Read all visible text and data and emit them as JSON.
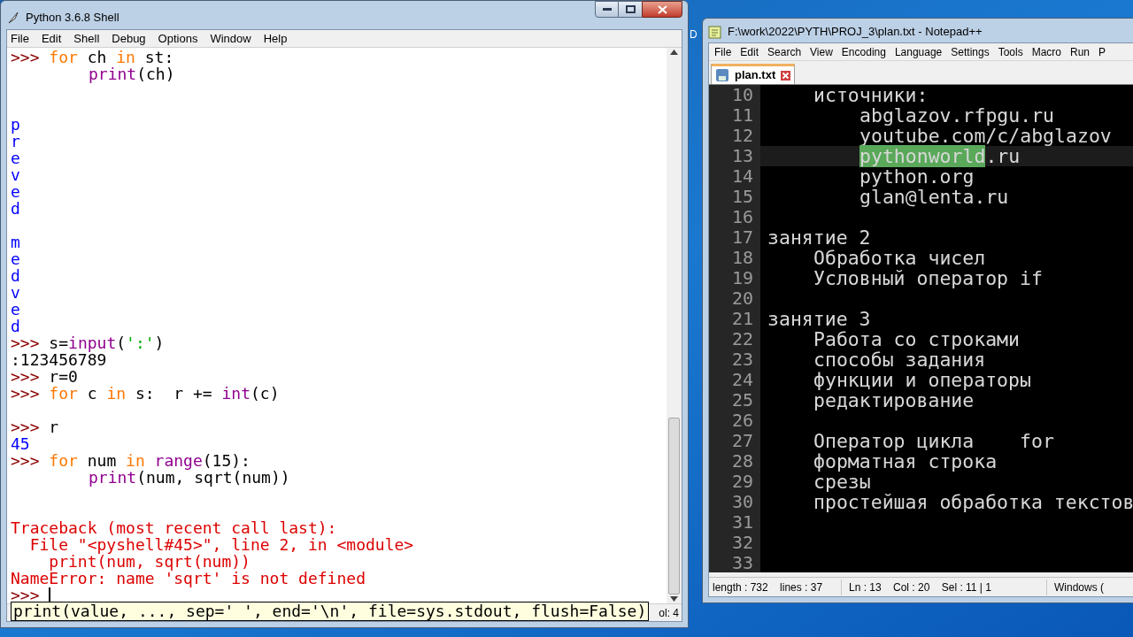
{
  "desktop": {
    "label": "D"
  },
  "shell": {
    "title": "Python 3.6.8 Shell",
    "menu": [
      "File",
      "Edit",
      "Shell",
      "Debug",
      "Options",
      "Window",
      "Help"
    ],
    "lines": [
      {
        "kind": "input",
        "segments": [
          {
            "kind": "prompt",
            "text": ">>> "
          },
          {
            "kind": "keyword",
            "text": "for"
          },
          {
            "kind": "plain",
            "text": " ch "
          },
          {
            "kind": "keyword",
            "text": "in"
          },
          {
            "kind": "plain",
            "text": " st:"
          }
        ]
      },
      {
        "kind": "continuation",
        "segments": [
          {
            "kind": "builtin",
            "text": "print"
          },
          {
            "kind": "plain",
            "text": "(ch)"
          }
        ]
      },
      {
        "kind": "blank"
      },
      {
        "kind": "blank"
      },
      {
        "kind": "input",
        "segments": [
          {
            "kind": "output",
            "text": "p"
          }
        ]
      },
      {
        "kind": "input",
        "segments": [
          {
            "kind": "output",
            "text": "r"
          }
        ]
      },
      {
        "kind": "input",
        "segments": [
          {
            "kind": "output",
            "text": "e"
          }
        ]
      },
      {
        "kind": "input",
        "segments": [
          {
            "kind": "output",
            "text": "v"
          }
        ]
      },
      {
        "kind": "input",
        "segments": [
          {
            "kind": "output",
            "text": "e"
          }
        ]
      },
      {
        "kind": "input",
        "segments": [
          {
            "kind": "output",
            "text": "d"
          }
        ]
      },
      {
        "kind": "blank"
      },
      {
        "kind": "input",
        "segments": [
          {
            "kind": "output",
            "text": "m"
          }
        ]
      },
      {
        "kind": "input",
        "segments": [
          {
            "kind": "output",
            "text": "e"
          }
        ]
      },
      {
        "kind": "input",
        "segments": [
          {
            "kind": "output",
            "text": "d"
          }
        ]
      },
      {
        "kind": "input",
        "segments": [
          {
            "kind": "output",
            "text": "v"
          }
        ]
      },
      {
        "kind": "input",
        "segments": [
          {
            "kind": "output",
            "text": "e"
          }
        ]
      },
      {
        "kind": "input",
        "segments": [
          {
            "kind": "output",
            "text": "d"
          }
        ]
      },
      {
        "kind": "input",
        "segments": [
          {
            "kind": "prompt",
            "text": ">>> "
          },
          {
            "kind": "plain",
            "text": "s="
          },
          {
            "kind": "builtin",
            "text": "input"
          },
          {
            "kind": "plain",
            "text": "("
          },
          {
            "kind": "string",
            "text": "':'"
          },
          {
            "kind": "plain",
            "text": ")"
          }
        ]
      },
      {
        "kind": "input",
        "segments": [
          {
            "kind": "plain",
            "text": ":123456789"
          }
        ]
      },
      {
        "kind": "input",
        "segments": [
          {
            "kind": "prompt",
            "text": ">>> "
          },
          {
            "kind": "plain",
            "text": "r=0"
          }
        ]
      },
      {
        "kind": "input",
        "segments": [
          {
            "kind": "prompt",
            "text": ">>> "
          },
          {
            "kind": "keyword",
            "text": "for"
          },
          {
            "kind": "plain",
            "text": " c "
          },
          {
            "kind": "keyword",
            "text": "in"
          },
          {
            "kind": "plain",
            "text": " s:  r += "
          },
          {
            "kind": "builtin",
            "text": "int"
          },
          {
            "kind": "plain",
            "text": "(c)"
          }
        ]
      },
      {
        "kind": "blank"
      },
      {
        "kind": "input",
        "segments": [
          {
            "kind": "prompt",
            "text": ">>> "
          },
          {
            "kind": "plain",
            "text": "r"
          }
        ]
      },
      {
        "kind": "input",
        "segments": [
          {
            "kind": "output",
            "text": "45"
          }
        ]
      },
      {
        "kind": "input",
        "segments": [
          {
            "kind": "prompt",
            "text": ">>> "
          },
          {
            "kind": "keyword",
            "text": "for"
          },
          {
            "kind": "plain",
            "text": " num "
          },
          {
            "kind": "keyword",
            "text": "in "
          },
          {
            "kind": "builtin",
            "text": "range"
          },
          {
            "kind": "plain",
            "text": "(15):"
          }
        ]
      },
      {
        "kind": "continuation",
        "segments": [
          {
            "kind": "builtin",
            "text": "print"
          },
          {
            "kind": "plain",
            "text": "(num, sqrt(num))"
          }
        ]
      },
      {
        "kind": "blank"
      },
      {
        "kind": "blank"
      },
      {
        "kind": "input",
        "segments": [
          {
            "kind": "error",
            "text": "Traceback (most recent call last):"
          }
        ]
      },
      {
        "kind": "input",
        "segments": [
          {
            "kind": "error",
            "text": "  File \"<pyshell#45>\", line 2, in <module>"
          }
        ]
      },
      {
        "kind": "input",
        "segments": [
          {
            "kind": "error",
            "text": "    print(num, sqrt(num))"
          }
        ]
      },
      {
        "kind": "input",
        "segments": [
          {
            "kind": "error",
            "text": "NameError: name 'sqrt' is not defined"
          }
        ]
      },
      {
        "kind": "input",
        "segments": [
          {
            "kind": "prompt",
            "text": ">>> "
          }
        ],
        "cursor": true
      }
    ],
    "calltip": "print(value, ..., sep=' ', end='\\n', file=sys.stdout, flush=False)",
    "status": "ol: 4"
  },
  "notepad": {
    "title": "F:\\work\\2022\\PYTH\\PROJ_3\\plan.txt - Notepad++",
    "menu": [
      "File",
      "Edit",
      "Search",
      "View",
      "Encoding",
      "Language",
      "Settings",
      "Tools",
      "Macro",
      "Run",
      "P"
    ],
    "tabs": [
      {
        "label": "plan.txt",
        "selected": true
      }
    ],
    "lines": [
      {
        "number": "10",
        "kind": "indented",
        "current": false,
        "segments": [
          {
            "text": "источники:",
            "selected": false
          }
        ]
      },
      {
        "number": "11",
        "kind": "nested",
        "current": false,
        "segments": [
          {
            "text": "abglazov.rfpgu.ru",
            "selected": false
          }
        ]
      },
      {
        "number": "12",
        "kind": "nested",
        "current": false,
        "segments": [
          {
            "text": "youtube.com/c/abglazov",
            "selected": false
          }
        ]
      },
      {
        "number": "13",
        "kind": "nested",
        "current": true,
        "segments": [
          {
            "text": "pythonworld",
            "selected": true
          },
          {
            "text": ".ru",
            "selected": false
          }
        ]
      },
      {
        "number": "14",
        "kind": "nested",
        "current": false,
        "segments": [
          {
            "text": "python.org",
            "selected": false
          }
        ]
      },
      {
        "number": "15",
        "kind": "nested",
        "current": false,
        "segments": [
          {
            "text": "glan@lenta.ru",
            "selected": false
          }
        ]
      },
      {
        "number": "16",
        "kind": "blank",
        "current": false
      },
      {
        "number": "17",
        "kind": "top",
        "current": false,
        "segments": [
          {
            "text": "занятие 2",
            "selected": false
          }
        ]
      },
      {
        "number": "18",
        "kind": "indented",
        "current": false,
        "segments": [
          {
            "text": "Обработка чисел",
            "selected": false
          }
        ]
      },
      {
        "number": "19",
        "kind": "indented",
        "current": false,
        "segments": [
          {
            "text": "Условный оператор if",
            "selected": false
          }
        ]
      },
      {
        "number": "20",
        "kind": "blank",
        "current": false
      },
      {
        "number": "21",
        "kind": "top",
        "current": false,
        "segments": [
          {
            "text": "занятие 3",
            "selected": false
          }
        ]
      },
      {
        "number": "22",
        "kind": "indented",
        "current": false,
        "segments": [
          {
            "text": "Работа со строками",
            "selected": false
          }
        ]
      },
      {
        "number": "23",
        "kind": "indented",
        "current": false,
        "segments": [
          {
            "text": "способы задания",
            "selected": false
          }
        ]
      },
      {
        "number": "24",
        "kind": "indented",
        "current": false,
        "segments": [
          {
            "text": "функции и операторы",
            "selected": false
          }
        ]
      },
      {
        "number": "25",
        "kind": "indented",
        "current": false,
        "segments": [
          {
            "text": "редактирование",
            "selected": false
          }
        ]
      },
      {
        "number": "26",
        "kind": "blank",
        "current": false
      },
      {
        "number": "27",
        "kind": "indented",
        "current": false,
        "segments": [
          {
            "text": "Оператор цикла    for",
            "selected": false
          }
        ]
      },
      {
        "number": "28",
        "kind": "indented",
        "current": false,
        "segments": [
          {
            "text": "форматная строка",
            "selected": false
          }
        ]
      },
      {
        "number": "29",
        "kind": "indented",
        "current": false,
        "segments": [
          {
            "text": "срезы",
            "selected": false
          }
        ]
      },
      {
        "number": "30",
        "kind": "indented",
        "current": false,
        "segments": [
          {
            "text": "простейшая обработка текстов",
            "selected": false
          }
        ]
      },
      {
        "number": "31",
        "kind": "blank",
        "current": false
      },
      {
        "number": "32",
        "kind": "blank",
        "current": false
      },
      {
        "number": "33",
        "kind": "blank",
        "current": false
      }
    ],
    "status": [
      "length : 732    lines : 37",
      "Ln : 13    Col : 20    Sel : 11 | 1",
      "Windows ("
    ]
  }
}
